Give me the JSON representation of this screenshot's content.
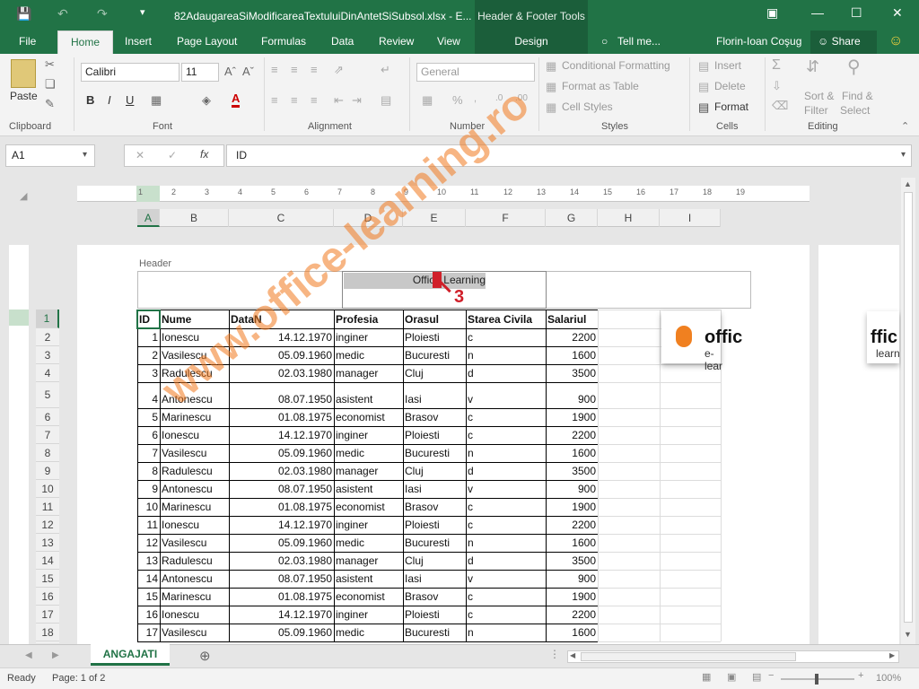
{
  "titlebar": {
    "title": "82AdaugareaSiModificareaTextuluiDinAntetSiSubsol.xlsx - E...",
    "context_tools": "Header & Footer Tools",
    "user": "Florin-Ioan Coşug",
    "share": "Share"
  },
  "tabs": [
    "File",
    "Home",
    "Insert",
    "Page Layout",
    "Formulas",
    "Data",
    "Review",
    "View",
    "Design"
  ],
  "tell_me": "Tell me...",
  "ribbon": {
    "paste": "Paste",
    "font_name": "Calibri",
    "font_size": "11",
    "number_format": "General",
    "conditional_formatting": "Conditional Formatting",
    "format_as_table": "Format as Table",
    "cell_styles": "Cell Styles",
    "insert": "Insert",
    "delete": "Delete",
    "format": "Format",
    "sort_filter_1": "Sort &",
    "sort_filter_2": "Filter",
    "find_select_1": "Find &",
    "find_select_2": "Select",
    "groups": {
      "clipboard": "Clipboard",
      "font": "Font",
      "alignment": "Alignment",
      "number": "Number",
      "styles": "Styles",
      "cells": "Cells",
      "editing": "Editing"
    }
  },
  "formula_bar": {
    "name_box": "A1",
    "value": "ID"
  },
  "ruler_numbers": [
    "1",
    "2",
    "3",
    "4",
    "5",
    "6",
    "7",
    "8",
    "9",
    "10",
    "11",
    "12",
    "13",
    "14",
    "15",
    "16",
    "17",
    "18",
    "19"
  ],
  "columns": [
    "A",
    "B",
    "C",
    "D",
    "E",
    "F",
    "G",
    "H",
    "I"
  ],
  "header_label": "Header",
  "header_text": "Office Learning",
  "annotation_number": "3",
  "row_numbers": [
    "1",
    "2",
    "3",
    "4",
    "5",
    "6",
    "7",
    "8",
    "9",
    "10",
    "11",
    "12",
    "13",
    "14",
    "15",
    "16",
    "17",
    "18"
  ],
  "table": {
    "headers": [
      "ID",
      "Nume",
      "DataN",
      "Profesia",
      "Orasul",
      "Starea Civila",
      "Salariul"
    ],
    "rows": [
      [
        "1",
        "Ionescu",
        "14.12.1970",
        "inginer",
        "Ploiesti",
        "c",
        "2200"
      ],
      [
        "2",
        "Vasilescu",
        "05.09.1960",
        "medic",
        "Bucuresti",
        "n",
        "1600"
      ],
      [
        "3",
        "Radulescu",
        "02.03.1980",
        "manager",
        "Cluj",
        "d",
        "3500"
      ],
      [
        "4",
        "Antonescu",
        "08.07.1950",
        "asistent",
        "Iasi",
        "v",
        "900"
      ],
      [
        "5",
        "Marinescu",
        "01.08.1975",
        "economist",
        "Brasov",
        "c",
        "1900"
      ],
      [
        "6",
        "Ionescu",
        "14.12.1970",
        "inginer",
        "Ploiesti",
        "c",
        "2200"
      ],
      [
        "7",
        "Vasilescu",
        "05.09.1960",
        "medic",
        "Bucuresti",
        "n",
        "1600"
      ],
      [
        "8",
        "Radulescu",
        "02.03.1980",
        "manager",
        "Cluj",
        "d",
        "3500"
      ],
      [
        "9",
        "Antonescu",
        "08.07.1950",
        "asistent",
        "Iasi",
        "v",
        "900"
      ],
      [
        "10",
        "Marinescu",
        "01.08.1975",
        "economist",
        "Brasov",
        "c",
        "1900"
      ],
      [
        "11",
        "Ionescu",
        "14.12.1970",
        "inginer",
        "Ploiesti",
        "c",
        "2200"
      ],
      [
        "12",
        "Vasilescu",
        "05.09.1960",
        "medic",
        "Bucuresti",
        "n",
        "1600"
      ],
      [
        "13",
        "Radulescu",
        "02.03.1980",
        "manager",
        "Cluj",
        "d",
        "3500"
      ],
      [
        "14",
        "Antonescu",
        "08.07.1950",
        "asistent",
        "Iasi",
        "v",
        "900"
      ],
      [
        "15",
        "Marinescu",
        "01.08.1975",
        "economist",
        "Brasov",
        "c",
        "1900"
      ],
      [
        "16",
        "Ionescu",
        "14.12.1970",
        "inginer",
        "Ploiesti",
        "c",
        "2200"
      ],
      [
        "17",
        "Vasilescu",
        "05.09.1960",
        "medic",
        "Bucuresti",
        "n",
        "1600"
      ]
    ]
  },
  "logo_text_1": "offic",
  "logo_text_2": "e-lear",
  "logo_text_3": "ffic",
  "logo_text_4": "learn",
  "watermark": "www.office-learning.ro",
  "sheet_tab": "ANGAJATI",
  "status": {
    "ready": "Ready",
    "page": "Page: 1 of 2",
    "zoom": "100%"
  },
  "colors": {
    "accent": "#217346",
    "watermark": "#f0781e"
  }
}
